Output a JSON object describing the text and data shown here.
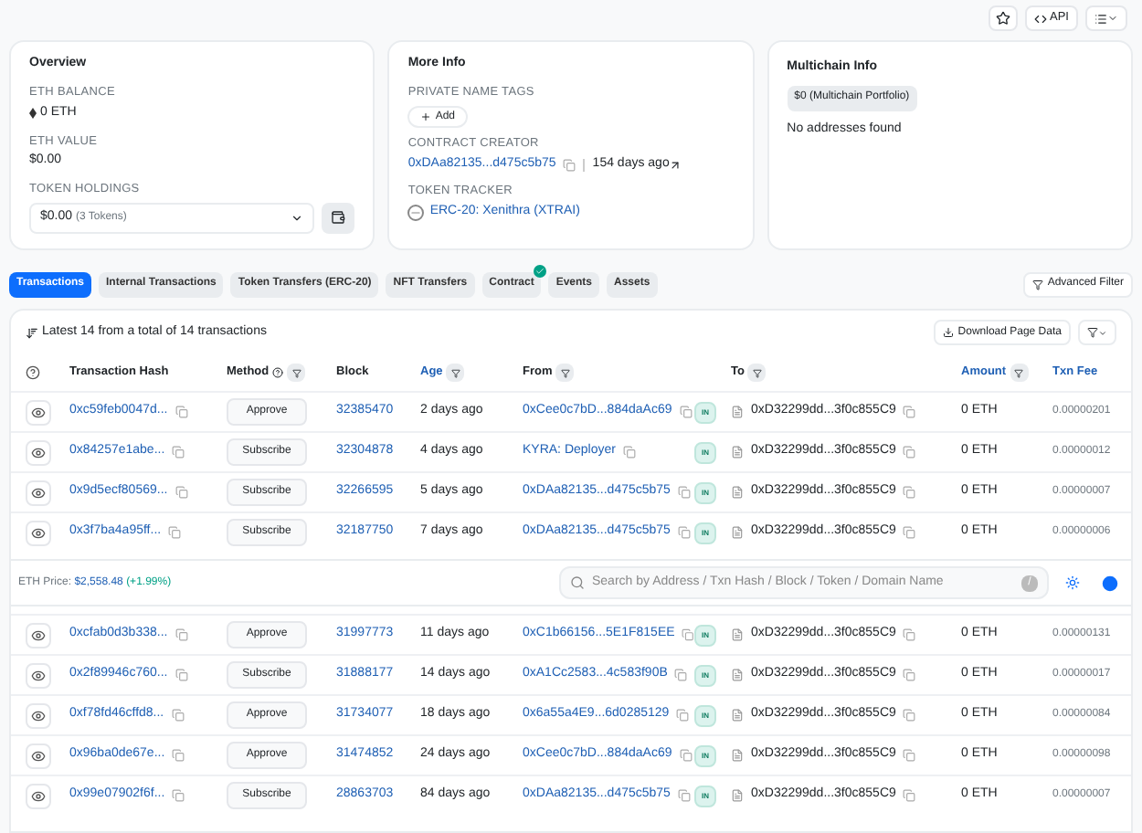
{
  "toolbar": {
    "api_label": "API"
  },
  "overview": {
    "title": "Overview",
    "eth_balance": {
      "label": "ETH BALANCE",
      "value": "0 ETH"
    },
    "eth_value": {
      "label": "ETH VALUE",
      "value": "$0.00"
    },
    "token_holdings": {
      "label": "TOKEN HOLDINGS",
      "value": "$0.00",
      "count": "(3 Tokens)"
    }
  },
  "more_info": {
    "title": "More Info",
    "private_name_tags": {
      "label": "PRIVATE NAME TAGS",
      "button": "Add"
    },
    "contract_creator": {
      "label": "CONTRACT CREATOR",
      "address": "0xDAa82135...d475c5b75",
      "age": "154 days ago"
    },
    "token_tracker": {
      "label": "TOKEN TRACKER",
      "value": "ERC-20: Xenithra (XTRAI)"
    }
  },
  "multichain_info": {
    "title": "Multichain Info",
    "badge": "$0 (Multichain Portfolio)",
    "empty_text": "No addresses found"
  },
  "tabs": [
    {
      "label": "Transactions",
      "selected": true,
      "verified": false
    },
    {
      "label": "Internal Transactions",
      "selected": false,
      "verified": false
    },
    {
      "label": "Token Transfers (ERC-20)",
      "selected": false,
      "verified": false
    },
    {
      "label": "NFT Transfers",
      "selected": false,
      "verified": false
    },
    {
      "label": "Contract",
      "selected": false,
      "verified": true
    },
    {
      "label": "Events",
      "selected": false,
      "verified": false
    },
    {
      "label": "Assets",
      "selected": false,
      "verified": false
    }
  ],
  "advanced_filter": "Advanced Filter",
  "table": {
    "summary": "Latest 14 from a total of 14 transactions",
    "download": "Download Page Data",
    "columns": [
      {
        "label": "Transaction Hash",
        "highlighted": false,
        "filter": false,
        "help": false
      },
      {
        "label": "Method",
        "highlighted": false,
        "filter": true,
        "help": true
      },
      {
        "label": "Block",
        "highlighted": false,
        "filter": false,
        "help": false
      },
      {
        "label": "Age",
        "highlighted": true,
        "filter": true,
        "help": false
      },
      {
        "label": "From",
        "highlighted": false,
        "filter": true,
        "help": false
      },
      {
        "label": "To",
        "highlighted": false,
        "filter": true,
        "help": false
      },
      {
        "label": "Amount",
        "highlighted": true,
        "filter": true,
        "help": false
      },
      {
        "label": "Txn Fee",
        "highlighted": true,
        "filter": false,
        "help": false
      }
    ],
    "rows_top": [
      {
        "hash": "0xc59feb0047d...",
        "method": "Approve",
        "block": "32385470",
        "age": "2 days ago",
        "from": "0xCee0c7bD...884daAc69",
        "direction": "IN",
        "to": "0xD32299dd...3f0c855C9",
        "amount": "0 ETH",
        "fee": "0.00000201"
      },
      {
        "hash": "0x84257e1abe...",
        "method": "Subscribe",
        "block": "32304878",
        "age": "4 days ago",
        "from": "KYRA: Deployer",
        "direction": "IN",
        "to": "0xD32299dd...3f0c855C9",
        "amount": "0 ETH",
        "fee": "0.00000012"
      },
      {
        "hash": "0x9d5ecf80569...",
        "method": "Subscribe",
        "block": "32266595",
        "age": "5 days ago",
        "from": "0xDAa82135...d475c5b75",
        "direction": "IN",
        "to": "0xD32299dd...3f0c855C9",
        "amount": "0 ETH",
        "fee": "0.00000007"
      },
      {
        "hash": "0x3f7ba4a95ff...",
        "method": "Subscribe",
        "block": "32187750",
        "age": "7 days ago",
        "from": "0xDAa82135...d475c5b75",
        "direction": "IN",
        "to": "0xD32299dd...3f0c855C9",
        "amount": "0 ETH",
        "fee": "0.00000006"
      }
    ],
    "rows_bottom": [
      {
        "hash": "0xcfab0d3b338...",
        "method": "Approve",
        "block": "31997773",
        "age": "11 days ago",
        "from": "0xC1b66156...5E1F815EE",
        "direction": "IN",
        "to": "0xD32299dd...3f0c855C9",
        "amount": "0 ETH",
        "fee": "0.00000131"
      },
      {
        "hash": "0x2f89946c760...",
        "method": "Subscribe",
        "block": "31888177",
        "age": "14 days ago",
        "from": "0xA1Cc2583...4c583f90B",
        "direction": "IN",
        "to": "0xD32299dd...3f0c855C9",
        "amount": "0 ETH",
        "fee": "0.00000017"
      },
      {
        "hash": "0xf78fd46cffd8...",
        "method": "Approve",
        "block": "31734077",
        "age": "18 days ago",
        "from": "0x6a55a4E9...6d0285129",
        "direction": "IN",
        "to": "0xD32299dd...3f0c855C9",
        "amount": "0 ETH",
        "fee": "0.00000084"
      },
      {
        "hash": "0x96ba0de67e...",
        "method": "Approve",
        "block": "31474852",
        "age": "24 days ago",
        "from": "0xCee0c7bD...884daAc69",
        "direction": "IN",
        "to": "0xD32299dd...3f0c855C9",
        "amount": "0 ETH",
        "fee": "0.00000098"
      },
      {
        "hash": "0x99e07902f6f...",
        "method": "Subscribe",
        "block": "28863703",
        "age": "84 days ago",
        "from": "0xDAa82135...d475c5b75",
        "direction": "IN",
        "to": "0xD32299dd...3f0c855C9",
        "amount": "0 ETH",
        "fee": "0.00000007"
      }
    ]
  },
  "footer": {
    "price_label": "ETH Price:",
    "price": "$2,558.48",
    "change": "(+1.99%)",
    "search_placeholder": "Search by Address / Txn Hash / Block / Token / Domain Name",
    "shortcut": "/"
  }
}
